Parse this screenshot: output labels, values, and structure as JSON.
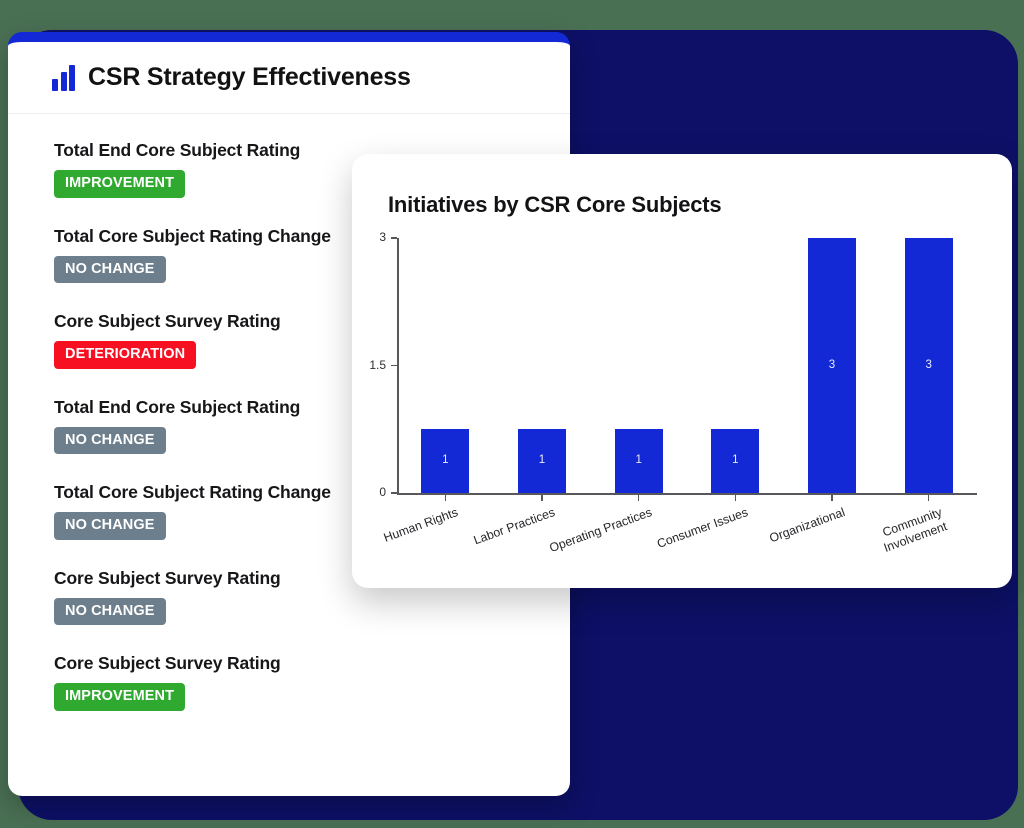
{
  "theme": {
    "page_background": "#4a7054",
    "frame_navy": "#0d1066",
    "accent_blue": "#1329d6",
    "badge_green": "#2fa930",
    "badge_gray": "#6d7f8c",
    "badge_red": "#f61022"
  },
  "panel": {
    "title": "CSR Strategy Effectiveness",
    "logo_icon": "bar-chart-icon",
    "metrics": [
      {
        "label": "Total End Core Subject Rating",
        "badge": "IMPROVEMENT",
        "badge_type": "improvement"
      },
      {
        "label": "Total Core Subject Rating Change",
        "badge": "NO CHANGE",
        "badge_type": "nochange"
      },
      {
        "label": "Core Subject Survey Rating",
        "badge": "DETERIORATION",
        "badge_type": "deterioration"
      },
      {
        "label": "Total End Core Subject Rating",
        "badge": "NO CHANGE",
        "badge_type": "nochange"
      },
      {
        "label": "Total Core Subject Rating Change",
        "badge": "NO CHANGE",
        "badge_type": "nochange"
      },
      {
        "label": "Core Subject Survey Rating",
        "badge": "NO CHANGE",
        "badge_type": "nochange"
      },
      {
        "label": "Core Subject Survey Rating",
        "badge": "IMPROVEMENT",
        "badge_type": "improvement"
      }
    ]
  },
  "chart_card": {
    "title": "Initiatives by CSR Core Subjects"
  },
  "chart_data": {
    "type": "bar",
    "title": "Initiatives by CSR Core Subjects",
    "xlabel": "",
    "ylabel": "",
    "categories": [
      "Human Rights",
      "Labor Practices",
      "Operating Practices",
      "Consumer Issues",
      "Organizational",
      "Community\nInvolvement"
    ],
    "values": [
      1,
      1,
      1,
      1,
      3,
      3
    ],
    "bar_display_heights": [
      0.75,
      0.75,
      0.75,
      0.75,
      3,
      3
    ],
    "value_labels": [
      "1",
      "1",
      "1",
      "1",
      "3",
      "3"
    ],
    "ylim": [
      0,
      3
    ],
    "yticks": [
      "0",
      "1.5",
      "3"
    ],
    "ytick_values": [
      0,
      1.5,
      3
    ],
    "grid": false,
    "legend": "none",
    "bar_color": "#1329d6",
    "value_label_color": "#e9ecff",
    "xlabel_rotation_deg": -20
  }
}
